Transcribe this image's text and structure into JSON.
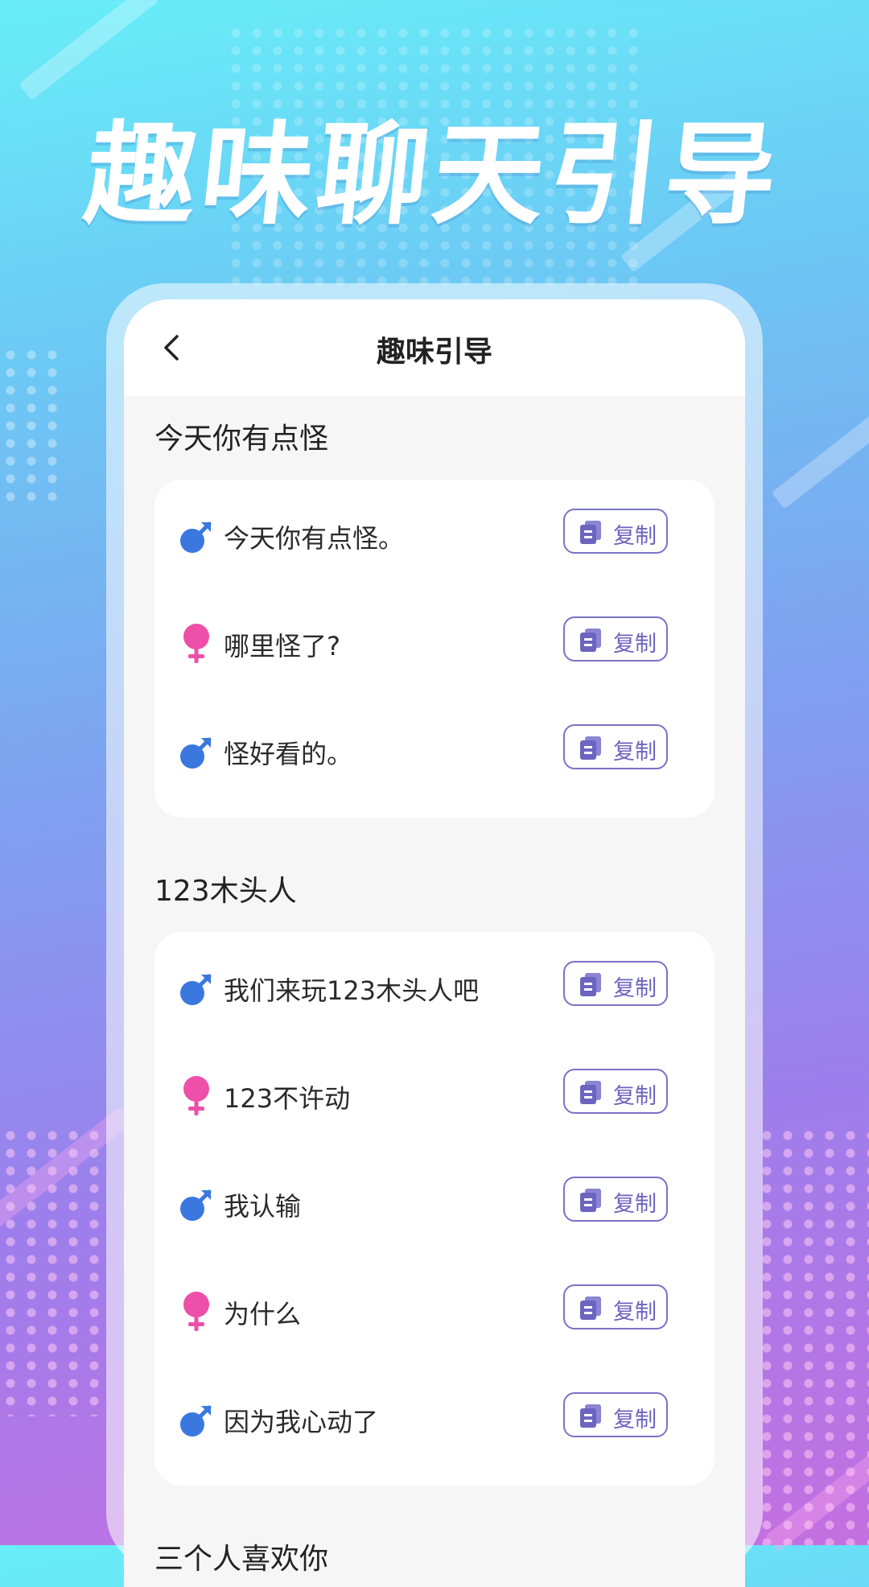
{
  "hero": {
    "title": "趣味聊天引导"
  },
  "nav": {
    "title": "趣味引导",
    "back_icon": "chevron-left-icon"
  },
  "colors": {
    "male": "#3a78e0",
    "female": "#ee4fa8",
    "copy_accent": "#6c64c0",
    "gradient": [
      "#68eef8",
      "#7fa0f0",
      "#c46fe0"
    ]
  },
  "sections": [
    {
      "title": "今天你有点怪",
      "items": [
        {
          "gender": "male",
          "text": "今天你有点怪。",
          "copy_label": "复制"
        },
        {
          "gender": "female",
          "text": "哪里怪了?",
          "copy_label": "复制"
        },
        {
          "gender": "male",
          "text": "怪好看的。",
          "copy_label": "复制"
        }
      ]
    },
    {
      "title": "123木头人",
      "items": [
        {
          "gender": "male",
          "text": "我们来玩123木头人吧",
          "copy_label": "复制"
        },
        {
          "gender": "female",
          "text": "123不许动",
          "copy_label": "复制"
        },
        {
          "gender": "male",
          "text": "我认输",
          "copy_label": "复制"
        },
        {
          "gender": "female",
          "text": "为什么",
          "copy_label": "复制"
        },
        {
          "gender": "male",
          "text": "因为我心动了",
          "copy_label": "复制"
        }
      ]
    },
    {
      "title": "三个人喜欢你",
      "items": []
    }
  ]
}
